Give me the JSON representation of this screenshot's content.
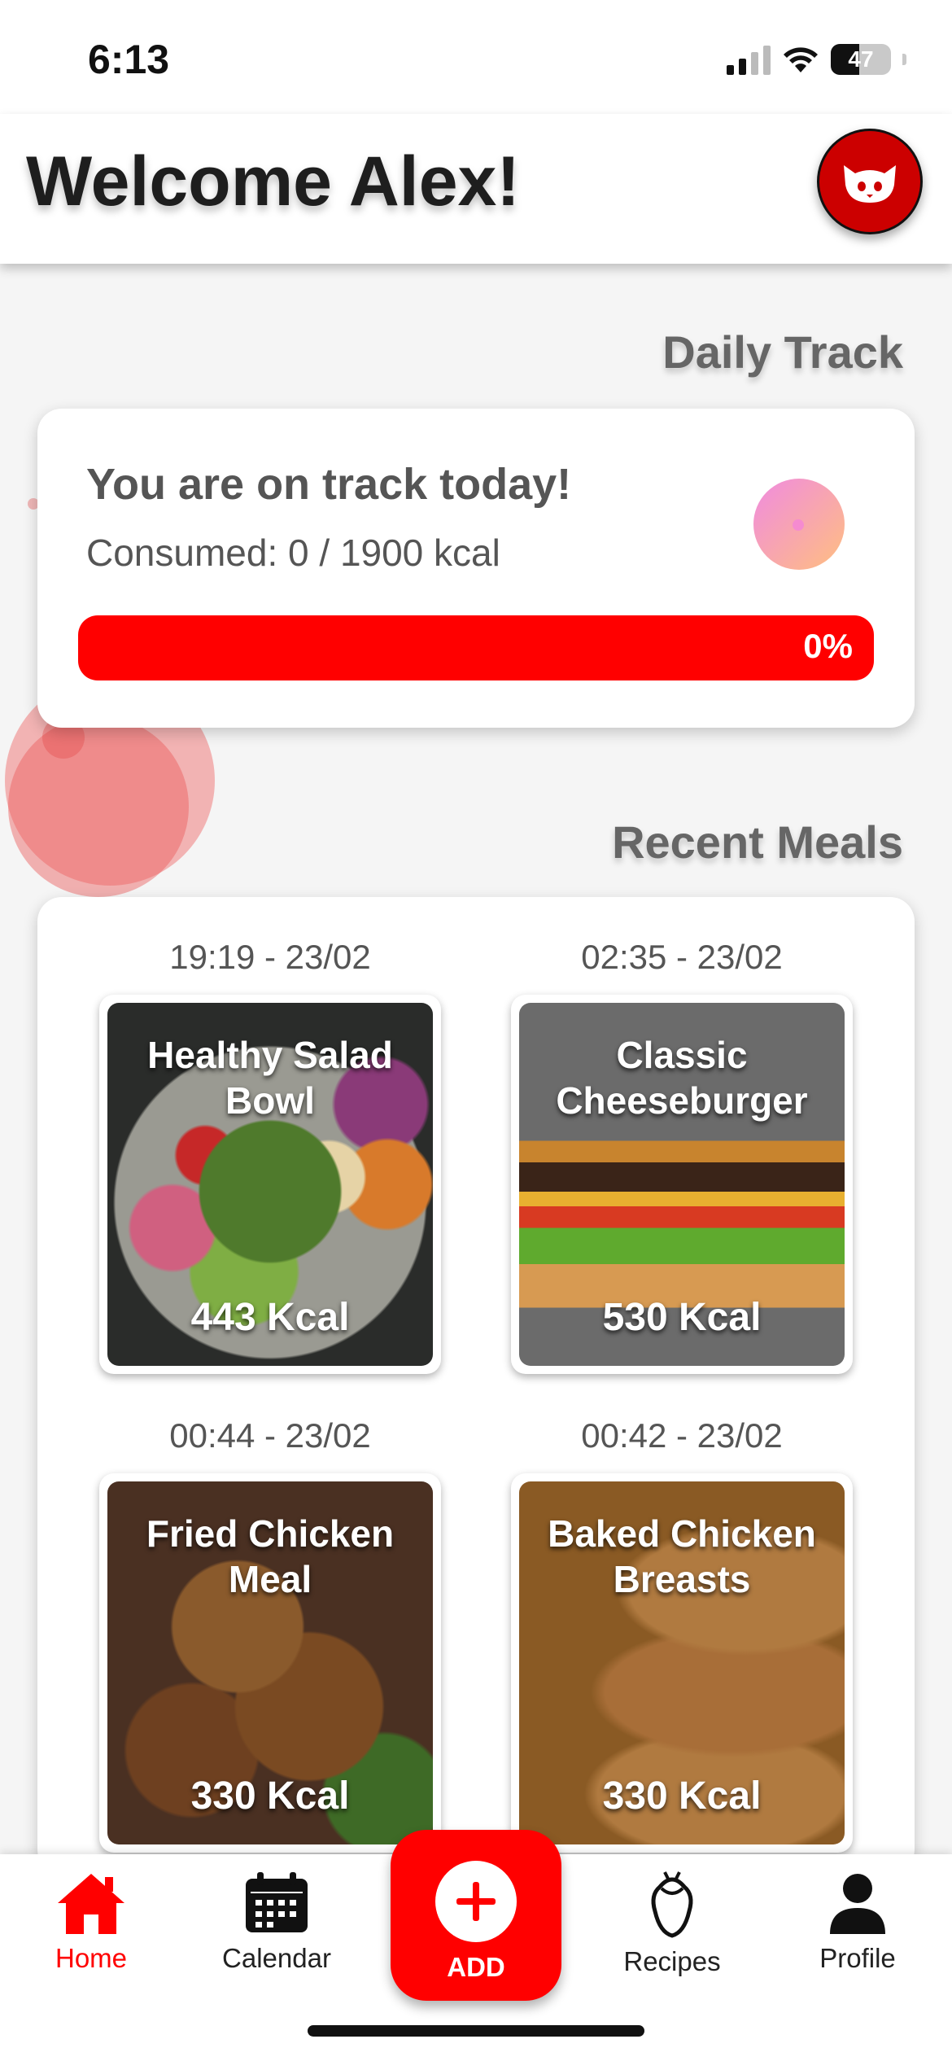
{
  "status_bar": {
    "time": "6:13",
    "battery_level": "47",
    "battery_fraction": 0.47,
    "icons": [
      "signal-icon",
      "wifi-icon",
      "battery-icon"
    ]
  },
  "header": {
    "title": "Welcome Alex!",
    "avatar_icon": "cat-icon"
  },
  "daily_track": {
    "section_title": "Daily Track",
    "heading": "You are on track today!",
    "consumed": "Consumed: 0 / 1900 kcal",
    "progress_label": "0%",
    "progress_value": 0
  },
  "recent_meals": {
    "section_title": "Recent Meals",
    "items": [
      {
        "time": "19:19 - 23/02",
        "name": "Healthy Salad Bowl",
        "kcal": "443 Kcal"
      },
      {
        "time": "02:35 - 23/02",
        "name": "Classic Cheeseburger",
        "kcal": "530 Kcal"
      },
      {
        "time": "00:44 - 23/02",
        "name": "Fried Chicken Meal",
        "kcal": "330 Kcal"
      },
      {
        "time": "00:42 - 23/02",
        "name": "Baked Chicken Breasts",
        "kcal": "330 Kcal"
      }
    ]
  },
  "tab_bar": {
    "active": "Home",
    "tabs": [
      {
        "label": "Home",
        "icon": "home-icon"
      },
      {
        "label": "Calendar",
        "icon": "calendar-icon"
      },
      {
        "label": "ADD",
        "icon": "plus-icon"
      },
      {
        "label": "Recipes",
        "icon": "food-icon"
      },
      {
        "label": "Profile",
        "icon": "person-icon"
      }
    ]
  },
  "colors": {
    "accent": "#ff0000",
    "avatar": "#cc0000",
    "text_muted": "#555555"
  }
}
